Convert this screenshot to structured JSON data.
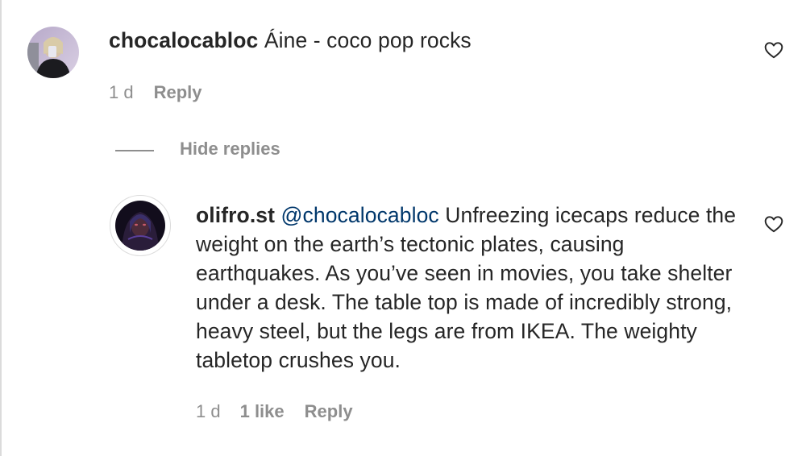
{
  "comment": {
    "username": "chocalocabloc",
    "text": "Áine - coco pop rocks",
    "time": "1 d",
    "reply_label": "Reply",
    "avatar_icon": "user-avatar-photo"
  },
  "toggle": {
    "label": "Hide replies"
  },
  "reply": {
    "username": "olifro.st",
    "mention": "@chocalocabloc",
    "text": "Unfreezing icecaps reduce the weight on the earth’s tectonic plates, causing earthquakes. As you’ve seen in movies, you take shelter under a desk. The table top is made of incredibly strong, heavy steel, but the legs are from IKEA. The weighty tabletop crushes you.",
    "time": "1 d",
    "likes": "1 like",
    "reply_label": "Reply",
    "avatar_icon": "user-avatar-photo"
  },
  "icons": {
    "like": "heart-outline-icon"
  }
}
